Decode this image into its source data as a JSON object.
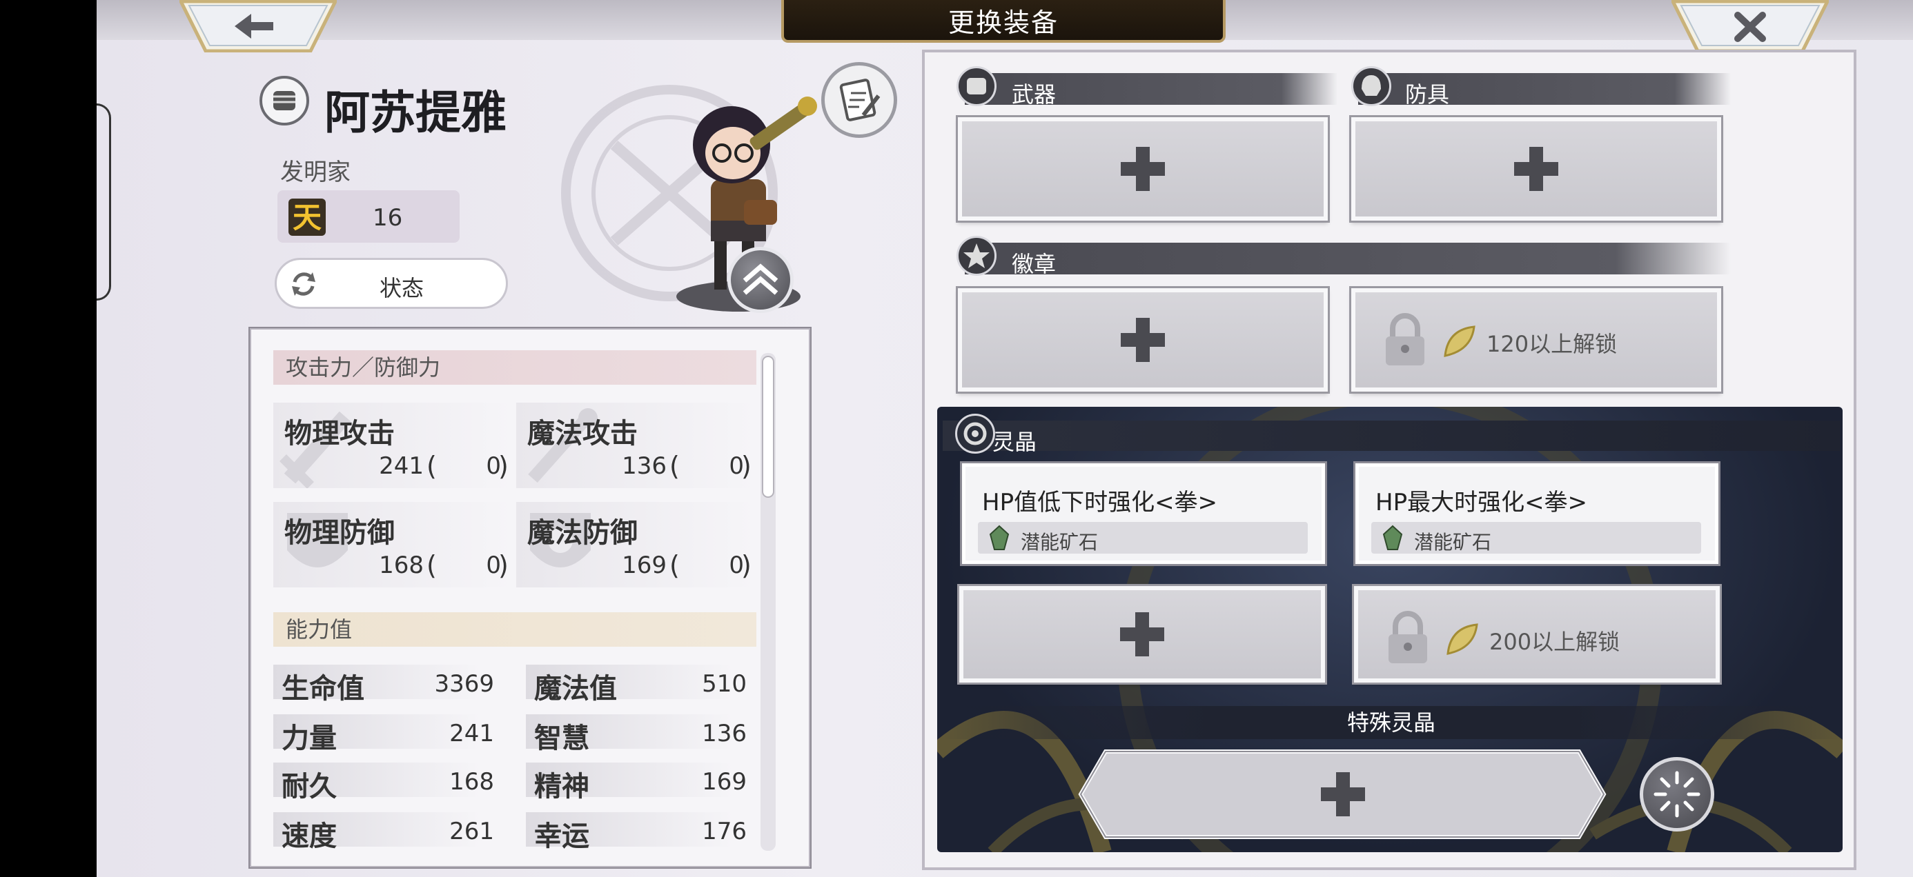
{
  "header": {
    "title": "更换装备"
  },
  "character": {
    "name": "阿苏提雅",
    "job": "发明家",
    "rank_value": "16",
    "status_label": "状态"
  },
  "attack_defense": {
    "heading": "攻击力／防御力",
    "items": [
      {
        "name": "物理攻击",
        "value": "241",
        "bonus": "0"
      },
      {
        "name": "魔法攻击",
        "value": "136",
        "bonus": "0"
      },
      {
        "name": "物理防御",
        "value": "168",
        "bonus": "0"
      },
      {
        "name": "魔法防御",
        "value": "169",
        "bonus": "0"
      }
    ]
  },
  "abilities": {
    "heading": "能力值",
    "items": [
      {
        "name": "生命值",
        "value": "3369"
      },
      {
        "name": "魔法值",
        "value": "510"
      },
      {
        "name": "力量",
        "value": "241"
      },
      {
        "name": "智慧",
        "value": "136"
      },
      {
        "name": "耐久",
        "value": "168"
      },
      {
        "name": "精神",
        "value": "169"
      },
      {
        "name": "速度",
        "value": "261"
      },
      {
        "name": "幸运",
        "value": "176"
      }
    ]
  },
  "equipment": {
    "weapon_label": "武器",
    "armor_label": "防具",
    "badge_label": "徽章",
    "badge_locked_text": "120以上解锁"
  },
  "crystals": {
    "heading": "灵晶",
    "slots": [
      {
        "name": "HP值低下时强化<拳>",
        "type": "潜能矿石"
      },
      {
        "name": "HP最大时强化<拳>",
        "type": "潜能矿石"
      }
    ],
    "locked_text": "200以上解锁",
    "special_label": "特殊灵晶"
  }
}
